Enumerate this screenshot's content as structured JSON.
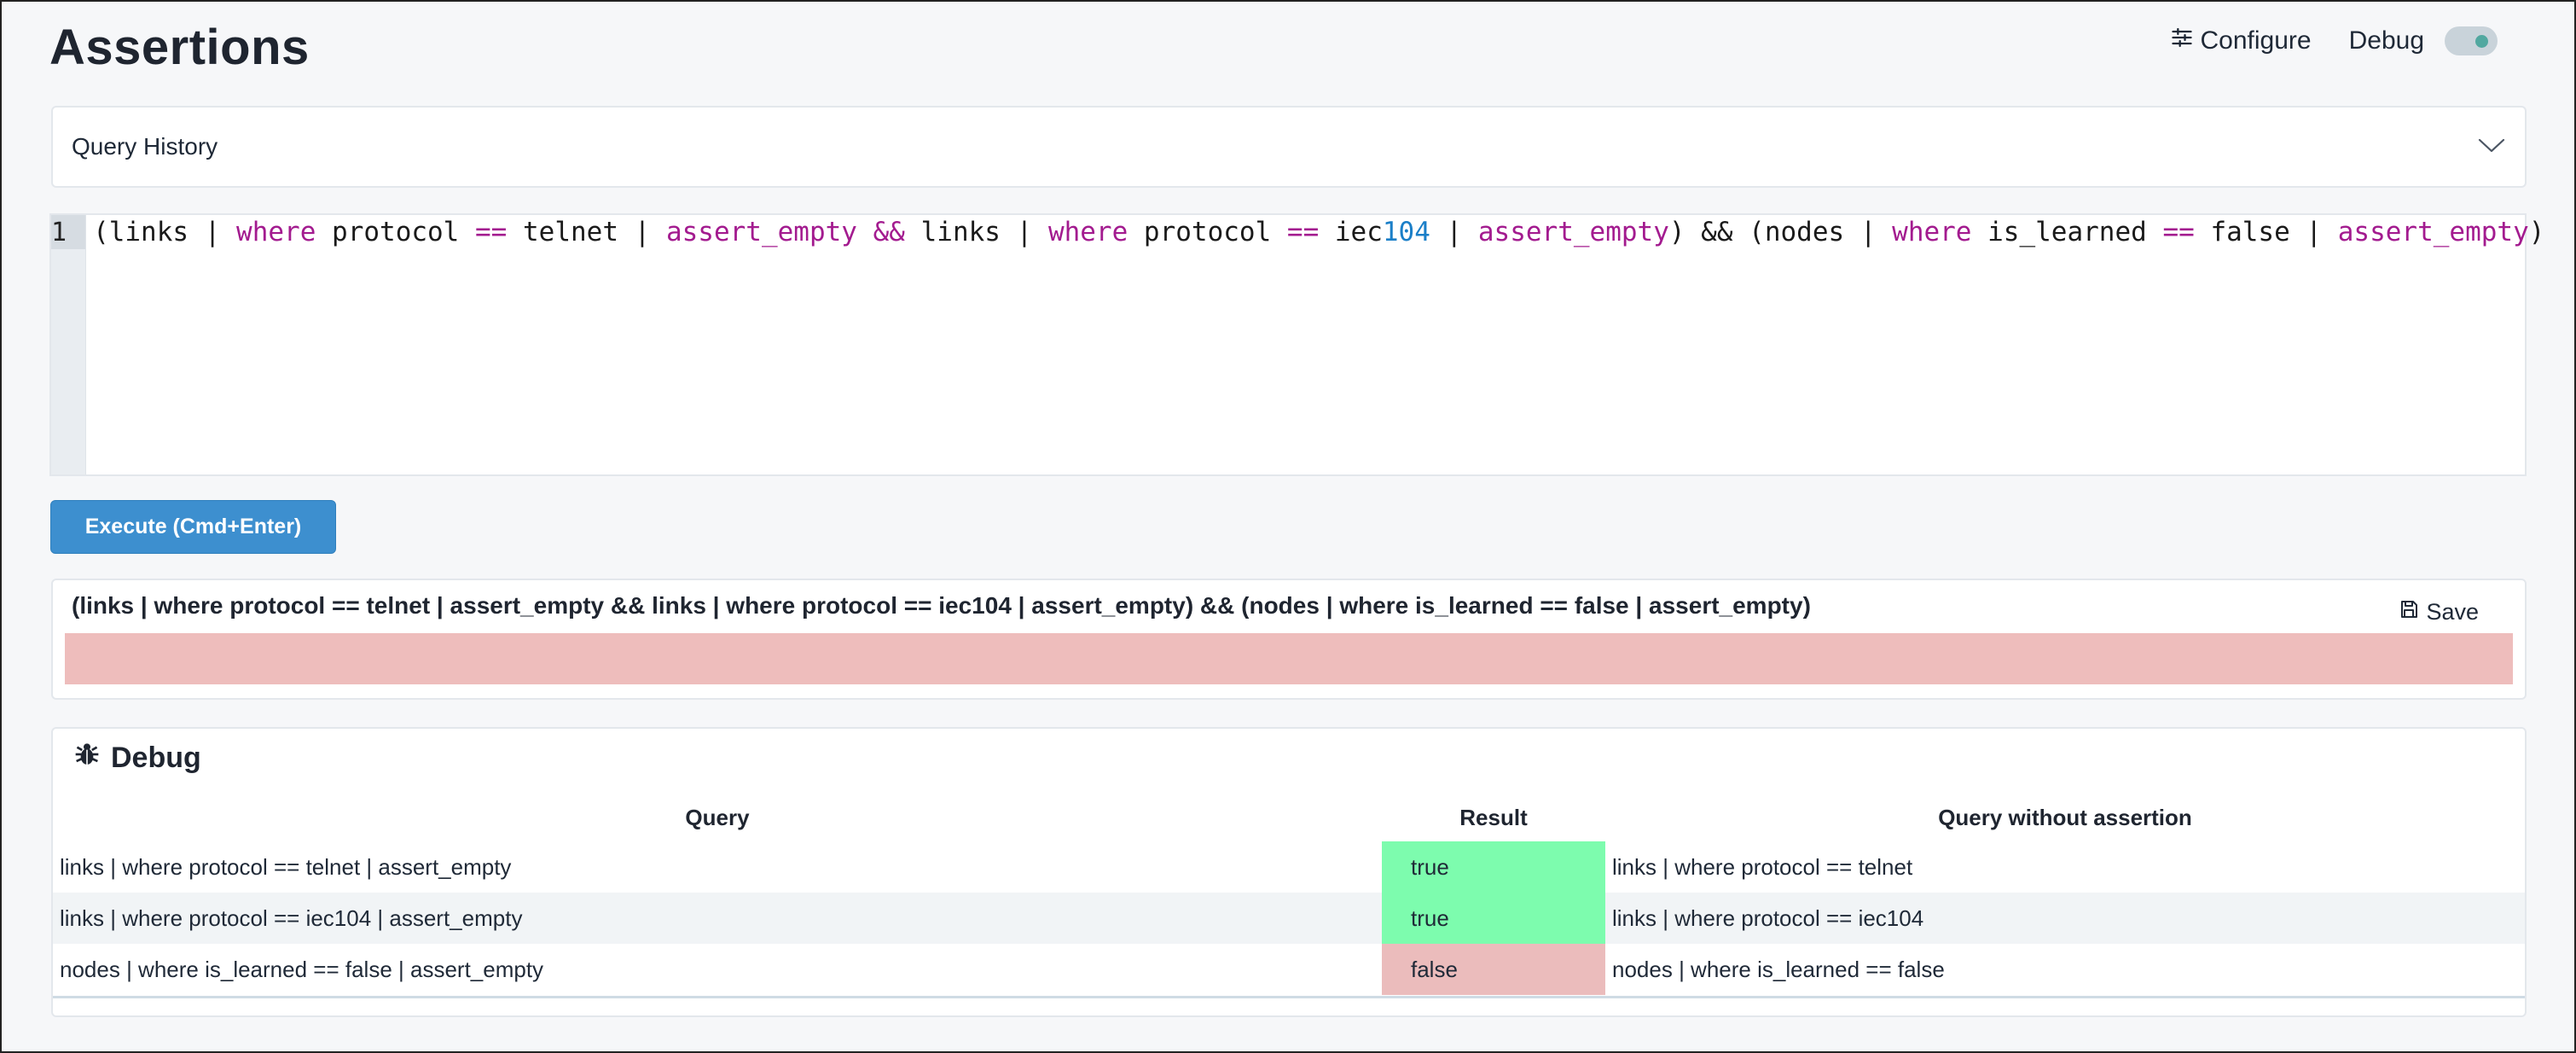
{
  "header": {
    "title": "Assertions",
    "configure_label": "Configure",
    "configure_icon": "sliders-icon",
    "debug_label": "Debug",
    "debug_enabled": true
  },
  "history": {
    "label": "Query History",
    "expand_icon": "chevron-down-icon"
  },
  "editor": {
    "line_number": "1",
    "tokens": [
      {
        "t": "(links | ",
        "c": ""
      },
      {
        "t": "where",
        "c": "kw"
      },
      {
        "t": " protocol ",
        "c": ""
      },
      {
        "t": "==",
        "c": "kw"
      },
      {
        "t": " telnet | ",
        "c": ""
      },
      {
        "t": "assert_empty",
        "c": "kw"
      },
      {
        "t": " ",
        "c": ""
      },
      {
        "t": "&&",
        "c": "kw"
      },
      {
        "t": " links | ",
        "c": ""
      },
      {
        "t": "where",
        "c": "kw"
      },
      {
        "t": " protocol ",
        "c": ""
      },
      {
        "t": "==",
        "c": "kw"
      },
      {
        "t": " iec",
        "c": ""
      },
      {
        "t": "104",
        "c": "num"
      },
      {
        "t": " | ",
        "c": ""
      },
      {
        "t": "assert_empty",
        "c": "kw"
      },
      {
        "t": ") && (nodes | ",
        "c": ""
      },
      {
        "t": "where",
        "c": "kw"
      },
      {
        "t": " is_learned ",
        "c": ""
      },
      {
        "t": "==",
        "c": "kw"
      },
      {
        "t": " false | ",
        "c": ""
      },
      {
        "t": "assert_empty",
        "c": "kw"
      },
      {
        "t": ")",
        "c": ""
      }
    ]
  },
  "execute": {
    "label": "Execute (Cmd+Enter)"
  },
  "result": {
    "query": "(links | where protocol == telnet | assert_empty && links | where protocol == iec104 | assert_empty) && (nodes | where is_learned == false | assert_empty)",
    "save_label": "Save",
    "status": "false",
    "status_color": "#eebdbc"
  },
  "debug": {
    "title": "Debug",
    "icon": "bug-icon",
    "columns": [
      "Query",
      "Result",
      "Query without assertion"
    ],
    "rows": [
      {
        "query": "links | where protocol == telnet | assert_empty",
        "result": "true",
        "query_without": "links | where protocol == telnet"
      },
      {
        "query": "links | where protocol == iec104 | assert_empty",
        "result": "true",
        "query_without": "links | where protocol == iec104"
      },
      {
        "query": "nodes | where is_learned == false | assert_empty",
        "result": "false",
        "query_without": "nodes | where is_learned == false"
      }
    ]
  },
  "colors": {
    "accent": "#3d8fcf",
    "true_bg": "#7dfcae",
    "false_bg": "#ebbcbc",
    "keyword": "#a31b8f",
    "number": "#1b7fc8"
  }
}
